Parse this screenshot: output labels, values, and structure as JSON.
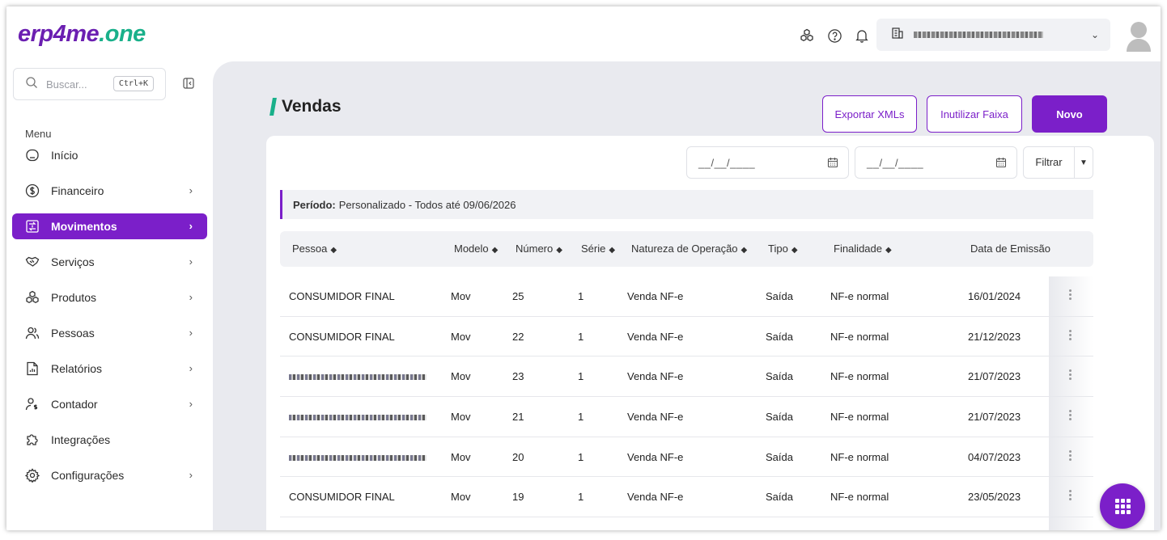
{
  "header": {
    "logo_part1": "erp4me",
    "logo_part2": ".one",
    "icons": [
      "modules-icon",
      "help-icon",
      "bell-icon"
    ],
    "company_selector_value": ""
  },
  "sidebar": {
    "search_placeholder": "Buscar...",
    "search_shortcut": "Ctrl+K",
    "menu_title": "Menu",
    "items": [
      {
        "label": "Início",
        "icon": "home-icon",
        "has_children": false,
        "active": false
      },
      {
        "label": "Financeiro",
        "icon": "dollar-icon",
        "has_children": true,
        "active": false
      },
      {
        "label": "Movimentos",
        "icon": "transfer-icon",
        "has_children": true,
        "active": true
      },
      {
        "label": "Serviços",
        "icon": "handshake-icon",
        "has_children": true,
        "active": false
      },
      {
        "label": "Produtos",
        "icon": "boxes-icon",
        "has_children": true,
        "active": false
      },
      {
        "label": "Pessoas",
        "icon": "users-icon",
        "has_children": true,
        "active": false
      },
      {
        "label": "Relatórios",
        "icon": "report-icon",
        "has_children": true,
        "active": false
      },
      {
        "label": "Contador",
        "icon": "accountant-icon",
        "has_children": true,
        "active": false
      },
      {
        "label": "Integrações",
        "icon": "puzzle-icon",
        "has_children": false,
        "active": false
      },
      {
        "label": "Configurações",
        "icon": "gear-icon",
        "has_children": true,
        "active": false
      }
    ]
  },
  "main": {
    "title": "Vendas",
    "buttons": {
      "export": "Exportar XMLs",
      "inutilizar": "Inutilizar Faixa",
      "novo": "Novo"
    },
    "date_from_placeholder": "__/__/____",
    "date_to_placeholder": "__/__/____",
    "filter_label": "Filtrar",
    "period_label": "Período:",
    "period_value": "Personalizado - Todos até 09/06/2026",
    "columns": [
      "Pessoa",
      "Modelo",
      "Número",
      "Série",
      "Natureza de Operação",
      "Tipo",
      "Finalidade",
      "Data de Emissão"
    ],
    "rows": [
      {
        "pessoa": "CONSUMIDOR FINAL",
        "modelo": "Mov",
        "numero": "25",
        "serie": "1",
        "natureza": "Venda NF-e",
        "tipo": "Saída",
        "finalidade": "NF-e normal",
        "data": "16/01/2024"
      },
      {
        "pessoa": "CONSUMIDOR FINAL",
        "modelo": "Mov",
        "numero": "22",
        "serie": "1",
        "natureza": "Venda NF-e",
        "tipo": "Saída",
        "finalidade": "NF-e normal",
        "data": "21/12/2023"
      },
      {
        "pessoa": "",
        "modelo": "Mov",
        "numero": "23",
        "serie": "1",
        "natureza": "Venda NF-e",
        "tipo": "Saída",
        "finalidade": "NF-e normal",
        "data": "21/07/2023"
      },
      {
        "pessoa": "",
        "modelo": "Mov",
        "numero": "21",
        "serie": "1",
        "natureza": "Venda NF-e",
        "tipo": "Saída",
        "finalidade": "NF-e normal",
        "data": "21/07/2023"
      },
      {
        "pessoa": "",
        "modelo": "Mov",
        "numero": "20",
        "serie": "1",
        "natureza": "Venda NF-e",
        "tipo": "Saída",
        "finalidade": "NF-e normal",
        "data": "04/07/2023"
      },
      {
        "pessoa": "CONSUMIDOR FINAL",
        "modelo": "Mov",
        "numero": "19",
        "serie": "1",
        "natureza": "Venda NF-e",
        "tipo": "Saída",
        "finalidade": "NF-e normal",
        "data": "23/05/2023"
      }
    ]
  },
  "colors": {
    "brand_purple": "#7b1fc9",
    "brand_green": "#19b08a",
    "main_bg": "#e9eaef"
  }
}
